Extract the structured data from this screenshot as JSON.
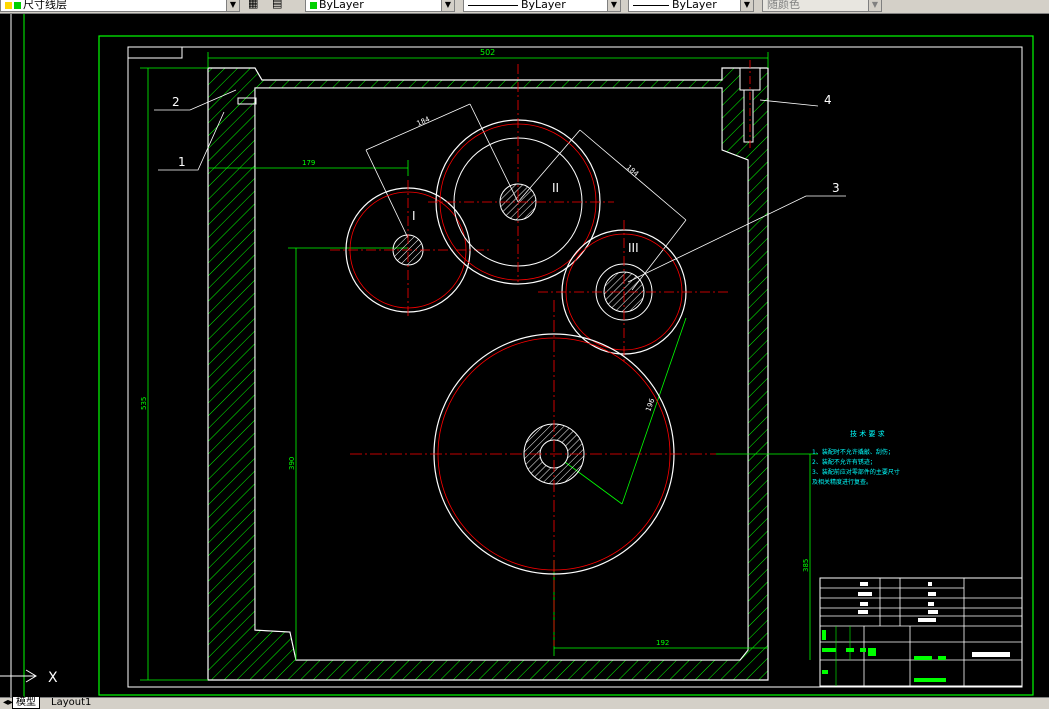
{
  "toolbar": {
    "layer_name": "尺寸线层",
    "color_value": "ByLayer",
    "linetype_value": "ByLayer",
    "lineweight_value": "ByLayer",
    "plotstyle_value": "随颜色"
  },
  "drawing": {
    "overall_width_dim": "502",
    "dim_top_left": "179",
    "dim_center_distance_1": "184",
    "dim_center_distance_2": "184",
    "dim_radius": "196",
    "dim_left_height": "535",
    "dim_inner_height": "390",
    "dim_right_height": "385",
    "dim_bottom": "192",
    "callout_1": "1",
    "callout_2": "2",
    "callout_3": "3",
    "callout_4": "4",
    "shaft_I": "I",
    "shaft_II": "II",
    "shaft_III": "III",
    "tech_title": "技 术 要 求",
    "tech_line1": "1、装配时不允许撬敲、刮伤；",
    "tech_line2": "2、装配不允许有锈迹；",
    "tech_line3": "3、装配前应对零部件的主要尺寸",
    "tech_line4": "及相关精度进行复查。"
  },
  "status": {
    "ucs_x_label": "X",
    "tab_model": "模型",
    "tab_layout1": "Layout1"
  },
  "colors": {
    "border": "#00ff00",
    "outline": "#ffffff",
    "center_line": "#ff0000",
    "text": "#00ffff",
    "hatch": "#00ff00"
  }
}
